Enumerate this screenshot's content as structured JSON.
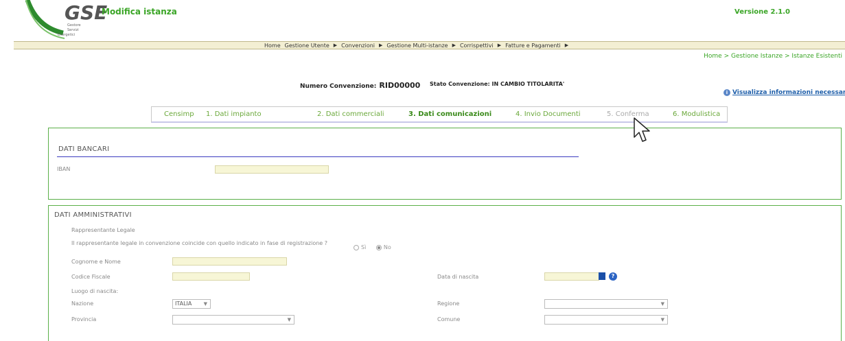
{
  "header": {
    "logo_text": "GSE",
    "logo_subtext": "Gestore Servizi Energetici",
    "app_title": "Modifica istanza",
    "version": "Versione 2.1.0"
  },
  "menu": {
    "items": [
      "Home",
      "Gestione Utente",
      "Convenzioni",
      "Gestione Multi-istanze",
      "Corrispettivi",
      "Fatture e Pagamenti"
    ]
  },
  "breadcrumb": "Home > Gestione Istanze > Istanze Esistenti",
  "convenzione": {
    "numero_label": "Numero Convenzione:",
    "numero_value": "RID00000",
    "stato_label": "Stato Convenzione:",
    "stato_value": "IN CAMBIO TITOLARITA'"
  },
  "info_link": "Visualizza informazioni necessarie",
  "tabs": [
    "Censimp",
    "1. Dati impianto",
    "2. Dati commerciali",
    "3. Dati comunicazioni",
    "4. Invio Documenti",
    "5. Conferma",
    "6. Modulistica"
  ],
  "bancari": {
    "title": "DATI BANCARI",
    "iban_label": "IBAN",
    "iban_value": ""
  },
  "amministrativi": {
    "title": "DATI AMMINISTRATIVI",
    "rappresentante_label": "Rappresentante Legale",
    "question": "Il rappresentante legale in convenzione coincide con quello indicato in fase di registrazione ?",
    "radio_si": "Sì",
    "radio_no": "No",
    "cognome_label": "Cognome e Nome",
    "codice_fiscale_label": "Codice Fiscale",
    "data_nascita_label": "Data di nascita",
    "luogo_nascita_label": "Luogo di nascita:",
    "nazione_label": "Nazione",
    "nazione_value": "ITALIA",
    "regione_label": "Regione",
    "provincia_label": "Provincia",
    "comune_label": "Comune"
  },
  "icons": {
    "info": "info-icon",
    "help": "help-icon",
    "calendar": "calendar-icon",
    "cursor": "mouse-cursor-icon"
  },
  "colors": {
    "brand_green": "#3aa526",
    "link_blue": "#1f5faa",
    "menu_bg": "#f3efd3",
    "field_bg": "#f7f6d6",
    "panel_border": "#5aaf48"
  }
}
